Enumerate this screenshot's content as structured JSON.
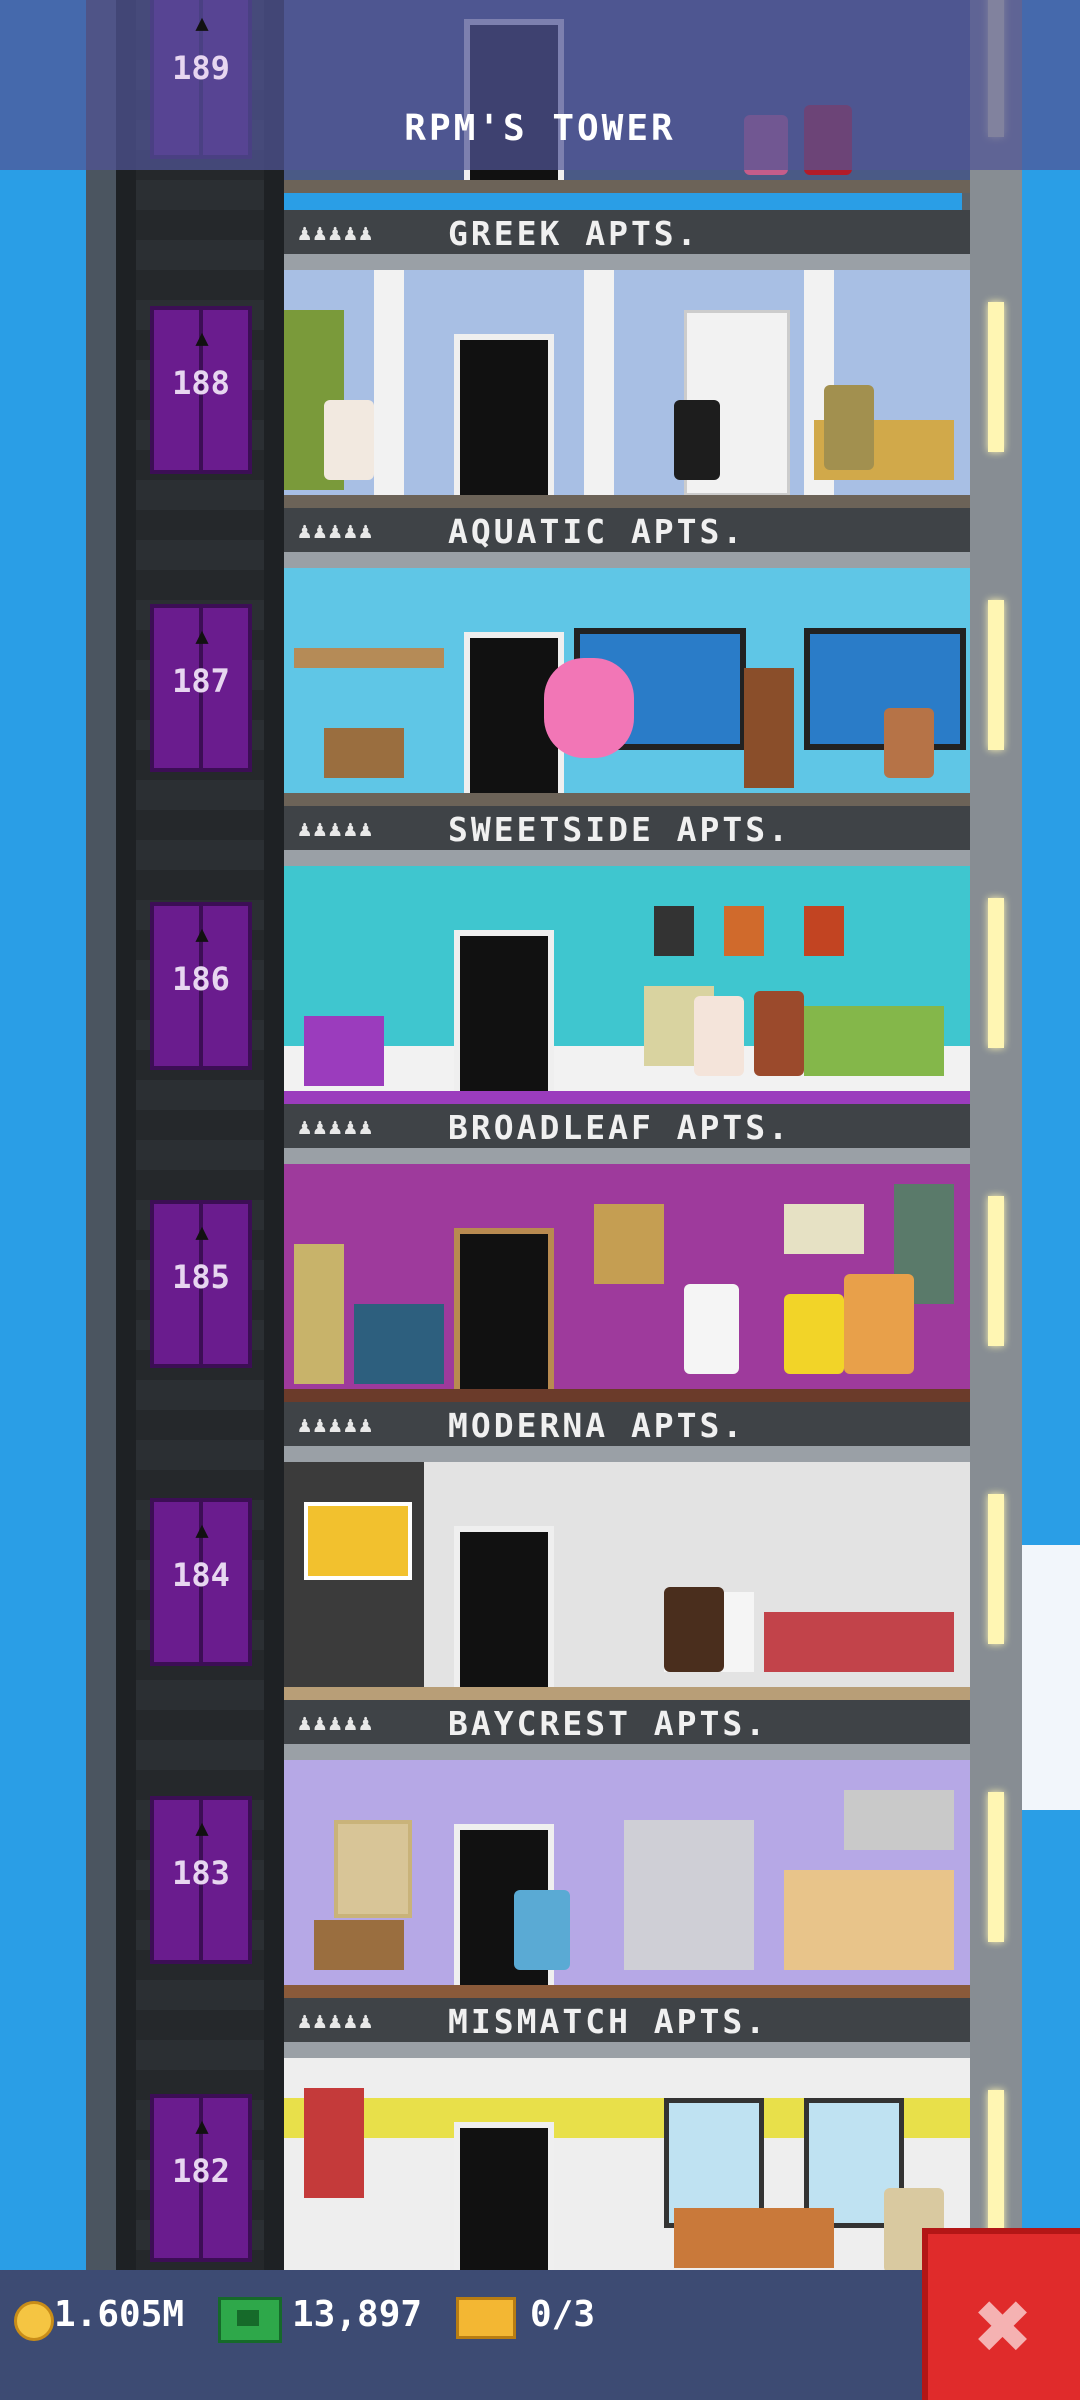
{
  "header": {
    "title": "RPM'S TOWER"
  },
  "floors": [
    {
      "number": "189",
      "name": "",
      "room_color": "#4a5a86"
    },
    {
      "number": "188",
      "name": "GREEK APTS.",
      "room_color": "#a8bfe4"
    },
    {
      "number": "187",
      "name": "AQUATIC APTS.",
      "room_color": "#5fc6e6"
    },
    {
      "number": "186",
      "name": "SWEETSIDE APTS.",
      "room_color": "#3fc6cf"
    },
    {
      "number": "185",
      "name": "BROADLEAF APTS.",
      "room_color": "#9e3a9c"
    },
    {
      "number": "184",
      "name": "MODERNA APTS.",
      "room_color": "#e3e3e3"
    },
    {
      "number": "183",
      "name": "BAYCREST APTS.",
      "room_color": "#b6a8e6"
    },
    {
      "number": "182",
      "name": "MISMATCH APTS.",
      "room_color": "#eeeeee"
    }
  ],
  "occupancy_icons": "♟♟♟♟♟",
  "footer": {
    "coins": "1.605M",
    "bux": "13,897",
    "tickets": "0/3"
  },
  "colors": {
    "elevator": "#6a1c8e",
    "close_button": "#e02b2b"
  }
}
